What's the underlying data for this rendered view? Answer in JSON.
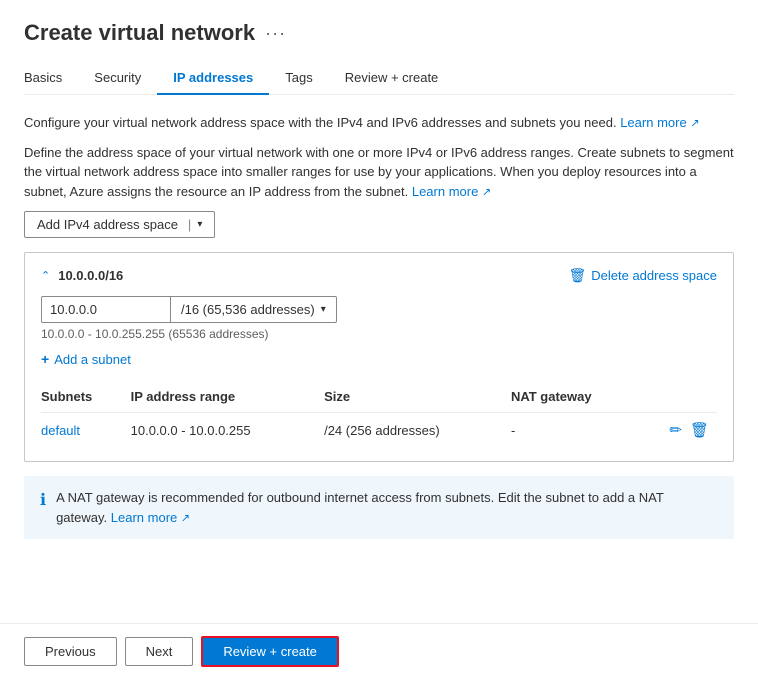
{
  "page": {
    "title": "Create virtual network",
    "ellipsis": "···"
  },
  "tabs": [
    {
      "id": "basics",
      "label": "Basics",
      "active": false
    },
    {
      "id": "security",
      "label": "Security",
      "active": false
    },
    {
      "id": "ip-addresses",
      "label": "IP addresses",
      "active": true
    },
    {
      "id": "tags",
      "label": "Tags",
      "active": false
    },
    {
      "id": "review-create",
      "label": "Review + create",
      "active": false
    }
  ],
  "description1": "Configure your virtual network address space with the IPv4 and IPv6 addresses and subnets you need.",
  "description1_link": "Learn more",
  "description2": "Define the address space of your virtual network with one or more IPv4 or IPv6 address ranges. Create subnets to segment the virtual network address space into smaller ranges for use by your applications. When you deploy resources into a subnet, Azure assigns the resource an IP address from the subnet.",
  "description2_link": "Learn more",
  "add_ipv4_btn": "Add IPv4 address space",
  "address_space": {
    "cidr": "10.0.0.0/16",
    "ip_value": "10.0.0.0",
    "ip_placeholder": "10.0.0.0",
    "cidr_option": "/16 (65,536 addresses)",
    "range_hint": "10.0.0.0 - 10.0.255.255 (65536 addresses)",
    "delete_label": "Delete address space",
    "add_subnet_label": "Add a subnet"
  },
  "subnets_table": {
    "columns": [
      "Subnets",
      "IP address range",
      "Size",
      "NAT gateway"
    ],
    "rows": [
      {
        "name": "default",
        "ip_range": "10.0.0.0 - 10.0.0.255",
        "size": "/24 (256 addresses)",
        "nat_gateway": "-"
      }
    ]
  },
  "info_banner": {
    "text": "A NAT gateway is recommended for outbound internet access from subnets. Edit the subnet to add a NAT gateway.",
    "link": "Learn more"
  },
  "buttons": {
    "previous": "Previous",
    "next": "Next",
    "review_create": "Review + create"
  }
}
